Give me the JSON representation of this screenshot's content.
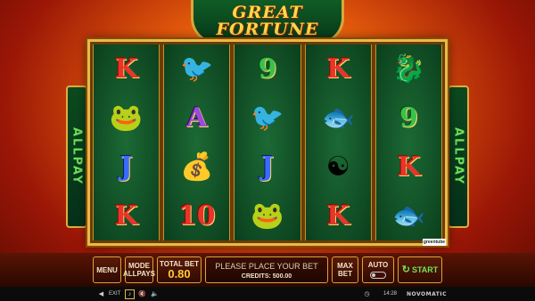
{
  "logo": {
    "line1": "GREAT",
    "line2": "FORTUNE"
  },
  "side_banner": {
    "left": "ALLPAY",
    "right": "ALLPAY"
  },
  "reels": [
    [
      "K",
      "frog",
      "J",
      "K"
    ],
    [
      "phoenix",
      "A",
      "gold-ingot",
      "10"
    ],
    [
      "9",
      "phoenix",
      "J",
      "frog"
    ],
    [
      "K",
      "koi",
      "yin-yang",
      "K"
    ],
    [
      "dragon",
      "9",
      "K",
      "koi"
    ]
  ],
  "provider_tag": "greentube",
  "controls": {
    "menu": "MENU",
    "mode_label": "MODE",
    "mode_value": "ALLPAYS",
    "total_bet_label": "TOTAL BET",
    "total_bet_value": "0.80",
    "message": "PLEASE PLACE YOUR BET",
    "credits": "CREDITS: 500.00",
    "max_bet_line1": "MAX",
    "max_bet_line2": "BET",
    "auto": "AUTO",
    "start": "START"
  },
  "status_bar": {
    "exit": "EXIT",
    "time": "14:28",
    "brand": "NOVOMATIC"
  },
  "colors": {
    "reel_green": "#0b3f1d",
    "gold": "#e8b94a",
    "accent_green": "#74e05a"
  }
}
